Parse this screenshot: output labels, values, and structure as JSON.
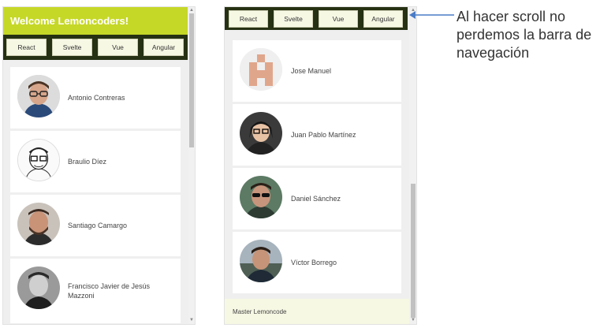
{
  "left_screen": {
    "title": "Welcome Lemoncoders!",
    "nav": [
      "React",
      "Svelte",
      "Vue",
      "Angular"
    ],
    "members": [
      {
        "name": "Antonio Contreras",
        "avatar": "photo-glasses-man"
      },
      {
        "name": "Braulio Díez",
        "avatar": "sketch-glasses-man"
      },
      {
        "name": "Santiago Camargo",
        "avatar": "photo-bearded-man"
      },
      {
        "name": "Francisco Javier de Jesús Mazzoni",
        "avatar": "photo-bw-man"
      }
    ]
  },
  "right_screen": {
    "nav": [
      "React",
      "Svelte",
      "Vue",
      "Angular"
    ],
    "members": [
      {
        "name": "Jose Manuel",
        "avatar": "identicon"
      },
      {
        "name": "Juan Pablo Martínez",
        "avatar": "cartoon-glasses"
      },
      {
        "name": "Daniel Sánchez",
        "avatar": "photo-sunglasses-man"
      },
      {
        "name": "Víctor Borrego",
        "avatar": "photo-outdoor-man"
      }
    ],
    "footer": "Master Lemoncode"
  },
  "annotation": "Al hacer scroll no perdemos la barra de navegación",
  "colors": {
    "header_accent": "#c6d827",
    "nav_bar": "#263113",
    "nav_button": "#f7f8e4",
    "footer_bg": "#f7f8e4",
    "arrow": "#4a7cc7"
  }
}
